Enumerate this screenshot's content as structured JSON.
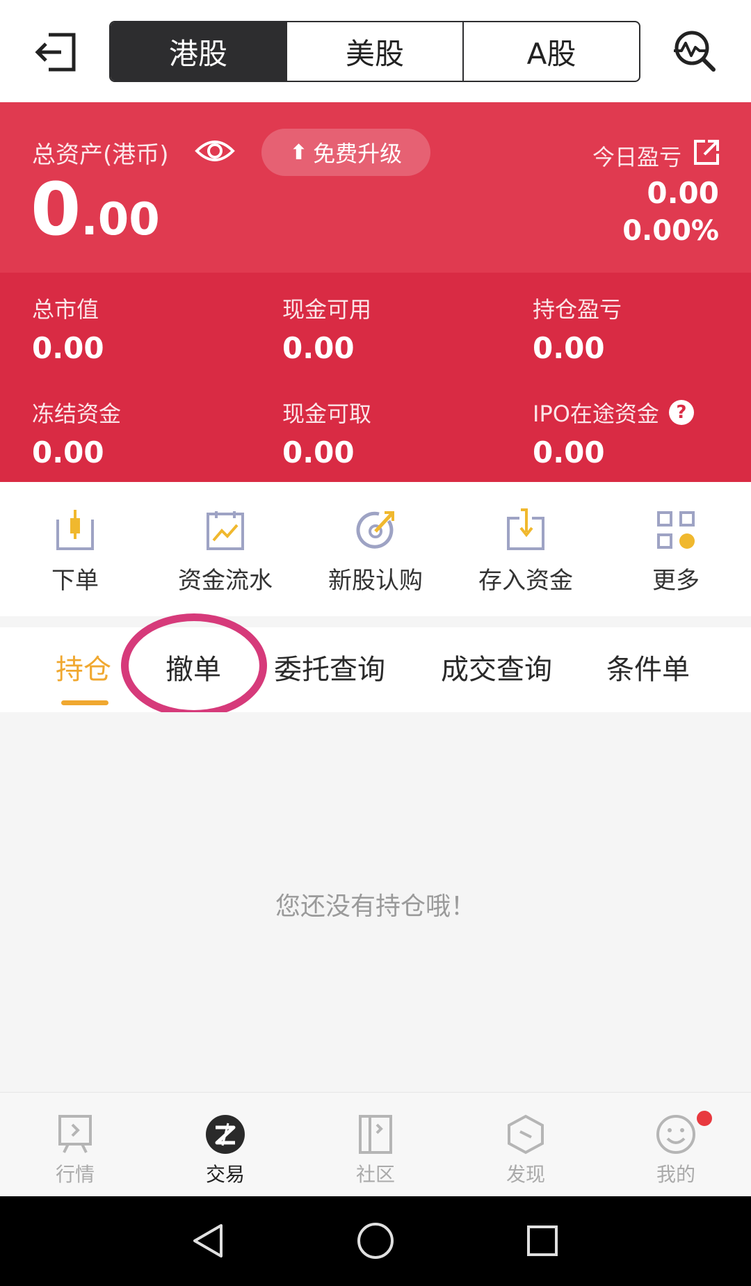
{
  "market_tabs": [
    "港股",
    "美股",
    "A股"
  ],
  "summary": {
    "total_assets_label": "总资产(港币)",
    "upgrade_label": "免费升级",
    "upgrade_arrow": "⬆",
    "total_int": "0",
    "total_dec": ".00",
    "today_label": "今日盈亏",
    "today_value": "0.00",
    "today_percent": "0.00%"
  },
  "stats": [
    {
      "label": "总市值",
      "value": "0.00"
    },
    {
      "label": "现金可用",
      "value": "0.00"
    },
    {
      "label": "持仓盈亏",
      "value": "0.00"
    },
    {
      "label": "冻结资金",
      "value": "0.00"
    },
    {
      "label": "现金可取",
      "value": "0.00"
    },
    {
      "label": "IPO在途资金",
      "value": "0.00",
      "help": "?"
    }
  ],
  "actions": [
    "下单",
    "资金流水",
    "新股认购",
    "存入资金",
    "更多"
  ],
  "tabs": [
    "持仓",
    "撤单",
    "委托查询",
    "成交查询",
    "条件单"
  ],
  "empty_message": "您还没有持仓哦！",
  "bottom_nav": [
    "行情",
    "交易",
    "社区",
    "发现",
    "我的"
  ],
  "colors": {
    "summary_top": "#e03a50",
    "summary_bottom": "#d92b44",
    "accent": "#f0a830",
    "highlight_ring": "#d63a7a",
    "segment_active": "#2d2d2f"
  }
}
